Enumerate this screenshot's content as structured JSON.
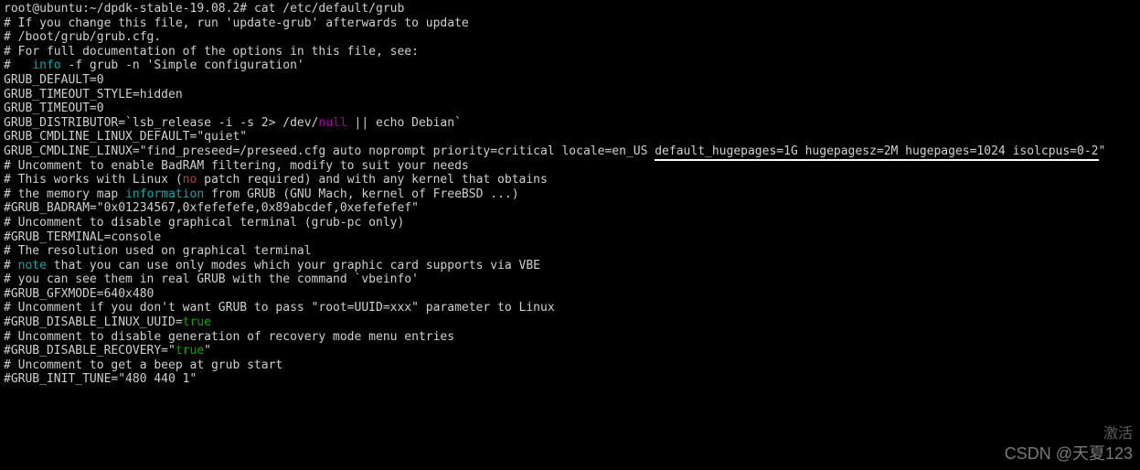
{
  "prompt": {
    "user_host": "root@ubuntu",
    "path": "~/dpdk-stable-19.08.2",
    "command": "cat /etc/default/grub"
  },
  "content": {
    "l01": "# If you change this file, run 'update-grub' afterwards to update",
    "l02": "# /boot/grub/grub.cfg.",
    "l03": "# For full documentation of the options in this file, see:",
    "l04a": "#   ",
    "l04b": "info",
    "l04c": " -f grub -n 'Simple configuration'",
    "l05": "",
    "l06": "GRUB_DEFAULT=0",
    "l07": "GRUB_TIMEOUT_STYLE=hidden",
    "l08": "GRUB_TIMEOUT=0",
    "l09a": "GRUB_DISTRIBUTOR=`lsb_release -i -s 2> /dev/",
    "l09b": "null",
    "l09c": " || echo Debian`",
    "l10": "GRUB_CMDLINE_LINUX_DEFAULT=\"quiet\"",
    "l11a": "GRUB_CMDLINE_LINUX=\"find_preseed=/preseed.cfg auto noprompt priority=critical locale=en_US ",
    "l11b": "default_hugepages=1G hugepagesz=2M hugepages=1024 isolcpus=0-2",
    "l11c": "\"",
    "l12": "",
    "l13": "# Uncomment to enable BadRAM filtering, modify to suit your needs",
    "l14a": "# This works with Linux (",
    "l14b": "no",
    "l14c": " patch required) and with any kernel that obtains",
    "l15a": "# the memory map ",
    "l15b": "information",
    "l15c": " from GRUB (GNU Mach, kernel of FreeBSD ...)",
    "l16": "#GRUB_BADRAM=\"0x01234567,0xfefefefe,0x89abcdef,0xefefefef\"",
    "l17": "",
    "l18": "# Uncomment to disable graphical terminal (grub-pc only)",
    "l19": "#GRUB_TERMINAL=console",
    "l20": "",
    "l21": "# The resolution used on graphical terminal",
    "l22a": "# ",
    "l22b": "note",
    "l22c": " that you can use only modes which your graphic card supports via VBE",
    "l23": "# you can see them in real GRUB with the command `vbeinfo'",
    "l24": "#GRUB_GFXMODE=640x480",
    "l25": "",
    "l26": "# Uncomment if you don't want GRUB to pass \"root=UUID=xxx\" parameter to Linux",
    "l27a": "#GRUB_DISABLE_LINUX_UUID=",
    "l27b": "true",
    "l28": "",
    "l29": "# Uncomment to disable generation of recovery mode menu entries",
    "l30a": "#GRUB_DISABLE_RECOVERY=\"",
    "l30b": "true",
    "l30c": "\"",
    "l31": "",
    "l32": "# Uncomment to get a beep at grub start",
    "l33": "#GRUB_INIT_TUNE=\"480 440 1\""
  },
  "watermark": {
    "activate": "激活",
    "csdn": "CSDN @天夏123"
  }
}
